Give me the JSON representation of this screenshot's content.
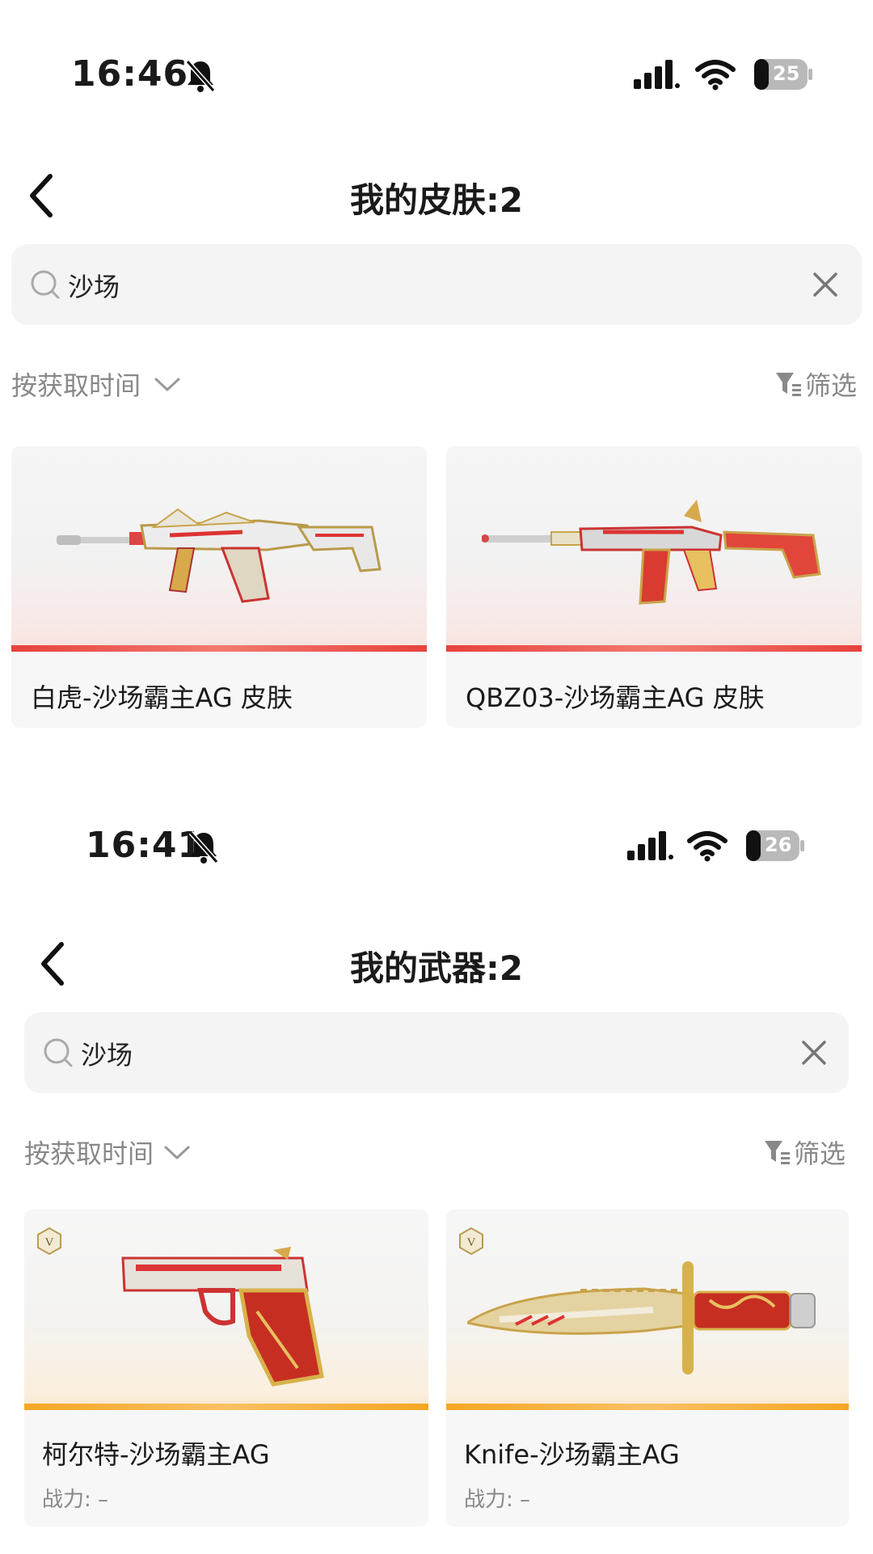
{
  "screen1": {
    "status": {
      "time": "16:46",
      "battery": "25"
    },
    "title": "我的皮肤:2",
    "search": {
      "value": "沙场"
    },
    "sort_label": "按获取时间",
    "filter_label": "筛选",
    "items": [
      {
        "name": "白虎-沙场霸主AG 皮肤"
      },
      {
        "name": "QBZ03-沙场霸主AG 皮肤"
      }
    ]
  },
  "screen2": {
    "status": {
      "time": "16:41",
      "battery": "26"
    },
    "title": "我的武器:2",
    "search": {
      "value": "沙场"
    },
    "sort_label": "按获取时间",
    "filter_label": "筛选",
    "items": [
      {
        "name": "柯尔特-沙场霸主AG",
        "power": "战力: –"
      },
      {
        "name": "Knife-沙场霸主AG",
        "power": "战力: –"
      }
    ]
  },
  "colors": {
    "skin_accent": "#e8423c",
    "weapon_accent": "#f5a623",
    "badge": "#b89a55"
  },
  "icons": [
    "bell-muted-icon",
    "signal-icon",
    "wifi-icon",
    "battery-icon",
    "back-icon",
    "search-icon",
    "clear-icon",
    "chevron-down-icon",
    "filter-icon",
    "v-badge-icon"
  ]
}
